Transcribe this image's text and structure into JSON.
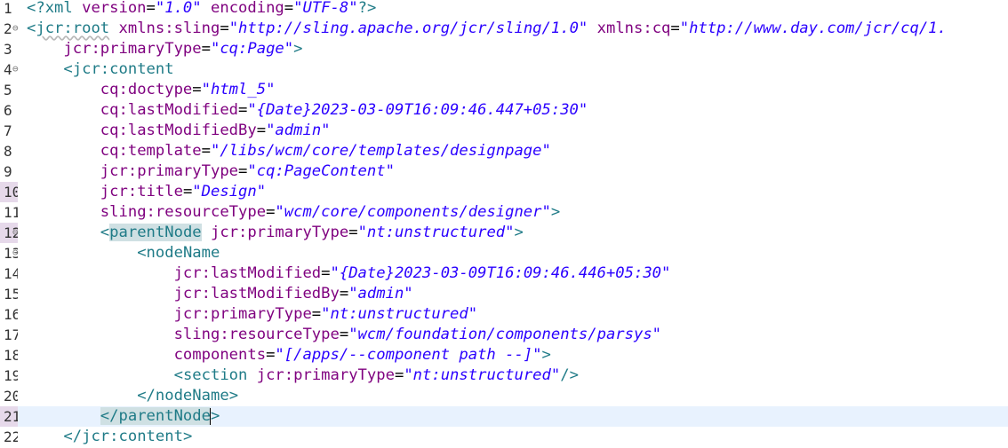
{
  "editor": {
    "lines": [
      {
        "n": "1",
        "fold": false,
        "marked": false
      },
      {
        "n": "2",
        "fold": true,
        "marked": false
      },
      {
        "n": "3",
        "fold": false,
        "marked": false
      },
      {
        "n": "4",
        "fold": true,
        "marked": false
      },
      {
        "n": "5",
        "fold": false,
        "marked": false
      },
      {
        "n": "6",
        "fold": false,
        "marked": false
      },
      {
        "n": "7",
        "fold": false,
        "marked": false
      },
      {
        "n": "8",
        "fold": false,
        "marked": false
      },
      {
        "n": "9",
        "fold": false,
        "marked": false
      },
      {
        "n": "10",
        "fold": false,
        "marked": true
      },
      {
        "n": "11",
        "fold": false,
        "marked": false
      },
      {
        "n": "12",
        "fold": true,
        "marked": true
      },
      {
        "n": "13",
        "fold": true,
        "marked": false
      },
      {
        "n": "14",
        "fold": false,
        "marked": false
      },
      {
        "n": "15",
        "fold": false,
        "marked": false
      },
      {
        "n": "16",
        "fold": false,
        "marked": false
      },
      {
        "n": "17",
        "fold": false,
        "marked": false
      },
      {
        "n": "18",
        "fold": false,
        "marked": false
      },
      {
        "n": "19",
        "fold": false,
        "marked": false
      },
      {
        "n": "20",
        "fold": false,
        "marked": false
      },
      {
        "n": "21",
        "fold": false,
        "marked": true
      },
      {
        "n": "22",
        "fold": false,
        "marked": false
      }
    ],
    "fold_glyph": "⊖",
    "current_line": "21",
    "code": {
      "l1": {
        "open": "<?xml ",
        "a1": "version",
        "eq1": "=",
        "v1": "\"1.0\"",
        "sp": " ",
        "a2": "encoding",
        "eq2": "=",
        "v2": "\"UTF-8\"",
        "close": "?>"
      },
      "l2": {
        "open": "<",
        "tag": "jcr:root",
        "sp": " ",
        "a1": "xmlns:sling",
        "eq1": "=",
        "v1": "\"http://sling.apache.org/jcr/sling/1.0\"",
        "sp2": " ",
        "a2": "xmlns:cq",
        "eq2": "=",
        "v2": "\"http://www.day.com/jcr/cq/1."
      },
      "l3": {
        "indent": "    ",
        "a": "jcr:primaryType",
        "eq": "=",
        "v": "\"cq:Page\"",
        "close": ">"
      },
      "l4": {
        "indent": "    ",
        "open": "<",
        "tag": "jcr:content"
      },
      "l5": {
        "indent": "        ",
        "a": "cq:doctype",
        "eq": "=",
        "v": "\"html_5\""
      },
      "l6": {
        "indent": "        ",
        "a": "cq:lastModified",
        "eq": "=",
        "v": "\"{Date}2023-03-09T16:09:46.447+05:30\""
      },
      "l7": {
        "indent": "        ",
        "a": "cq:lastModifiedBy",
        "eq": "=",
        "v": "\"admin\""
      },
      "l8": {
        "indent": "        ",
        "a": "cq:template",
        "eq": "=",
        "v": "\"/libs/wcm/core/templates/designpage\""
      },
      "l9": {
        "indent": "        ",
        "a": "jcr:primaryType",
        "eq": "=",
        "v": "\"cq:PageContent\""
      },
      "l10": {
        "indent": "        ",
        "a": "jcr:title",
        "eq": "=",
        "v": "\"Design\""
      },
      "l11": {
        "indent": "        ",
        "a": "sling:resourceType",
        "eq": "=",
        "v": "\"wcm/core/components/designer\"",
        "close": ">"
      },
      "l12": {
        "indent": "        ",
        "open": "<",
        "tag": "parentNode",
        "sp": " ",
        "a": "jcr:primaryType",
        "eq": "=",
        "v": "\"nt:unstructured\"",
        "close": ">"
      },
      "l13": {
        "indent": "            ",
        "open": "<",
        "tag": "nodeName"
      },
      "l14": {
        "indent": "                ",
        "a": "jcr:lastModified",
        "eq": "=",
        "v": "\"{Date}2023-03-09T16:09:46.446+05:30\""
      },
      "l15": {
        "indent": "                ",
        "a": "jcr:lastModifiedBy",
        "eq": "=",
        "v": "\"admin\""
      },
      "l16": {
        "indent": "                ",
        "a": "jcr:primaryType",
        "eq": "=",
        "v": "\"nt:unstructured\""
      },
      "l17": {
        "indent": "                ",
        "a": "sling:resourceType",
        "eq": "=",
        "v": "\"wcm/foundation/components/parsys\""
      },
      "l18": {
        "indent": "                ",
        "a": "components",
        "eq": "=",
        "v": "\"[/apps/--component path --]\"",
        "close": ">"
      },
      "l19": {
        "indent": "                ",
        "open": "<",
        "tag": "section",
        "sp": " ",
        "a": "jcr:primaryType",
        "eq": "=",
        "v": "\"nt:unstructured\"",
        "close": "/>"
      },
      "l20": {
        "indent": "            ",
        "open": "</",
        "tag": "nodeName",
        "close": ">"
      },
      "l21": {
        "indent": "        ",
        "open": "</",
        "tag": "parentNode",
        "close": ">"
      },
      "l22": {
        "indent": "    ",
        "open": "</",
        "tag": "jcr:content",
        "close": ">"
      }
    }
  }
}
